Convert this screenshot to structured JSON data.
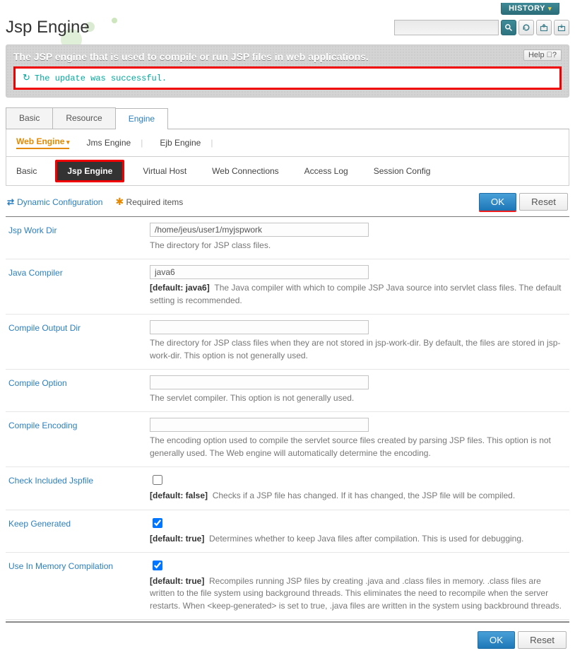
{
  "header": {
    "history_label": "HISTORY",
    "page_title": "Jsp Engine"
  },
  "search": {
    "value": "",
    "placeholder": ""
  },
  "banner": {
    "description": "The JSP engine that is used to compile or run JSP files in web applications.",
    "help_label": "Help ⃝?",
    "notice": "The update was successful."
  },
  "tabs_primary": {
    "items": [
      "Basic",
      "Resource",
      "Engine"
    ],
    "active": "Engine"
  },
  "tabs_secondary": {
    "items": [
      "Web Engine",
      "Jms Engine",
      "Ejb Engine"
    ],
    "active": "Web Engine"
  },
  "tabs_tertiary": {
    "items": [
      "Basic",
      "Jsp Engine",
      "Virtual Host",
      "Web Connections",
      "Access Log",
      "Session Config"
    ],
    "active": "Jsp Engine"
  },
  "legend": {
    "dynamic": "Dynamic Configuration",
    "required": "Required items"
  },
  "buttons": {
    "ok": "OK",
    "reset": "Reset"
  },
  "fields": {
    "jsp_work_dir": {
      "label": "Jsp Work Dir",
      "value": "/home/jeus/user1/myjspwork",
      "desc": "The directory for JSP class files."
    },
    "java_compiler": {
      "label": "Java Compiler",
      "value": "java6",
      "default": "[default: java6]",
      "desc": "The Java compiler with which to compile JSP Java source into servlet class files. The default setting is recommended."
    },
    "compile_output_dir": {
      "label": "Compile Output Dir",
      "value": "",
      "desc": "The directory for JSP class files when they are not stored in jsp-work-dir. By default, the files are stored in jsp-work-dir. This option is not generally used."
    },
    "compile_option": {
      "label": "Compile Option",
      "value": "",
      "desc": "The servlet compiler. This option is not generally used."
    },
    "compile_encoding": {
      "label": "Compile Encoding",
      "value": "",
      "desc": "The encoding option used to compile the servlet source files created by parsing JSP files. This option is not generally used. The Web engine will automatically determine the encoding."
    },
    "check_included": {
      "label": "Check Included Jspfile",
      "checked": false,
      "default": "[default: false]",
      "desc": "Checks if a JSP file has changed. If it has changed, the JSP file will be compiled."
    },
    "keep_generated": {
      "label": "Keep Generated",
      "checked": true,
      "default": "[default: true]",
      "desc": "Determines whether to keep Java files after compilation. This is used for debugging."
    },
    "in_memory": {
      "label": "Use In Memory Compilation",
      "checked": true,
      "default": "[default: true]",
      "desc": "Recompiles running JSP files by creating .java and .class files in memory. .class files are written to the file system using background threads. This eliminates the need to recompile when the server restarts. When <keep-generated> is set to true, .java files are written in the system using backbround threads."
    }
  }
}
